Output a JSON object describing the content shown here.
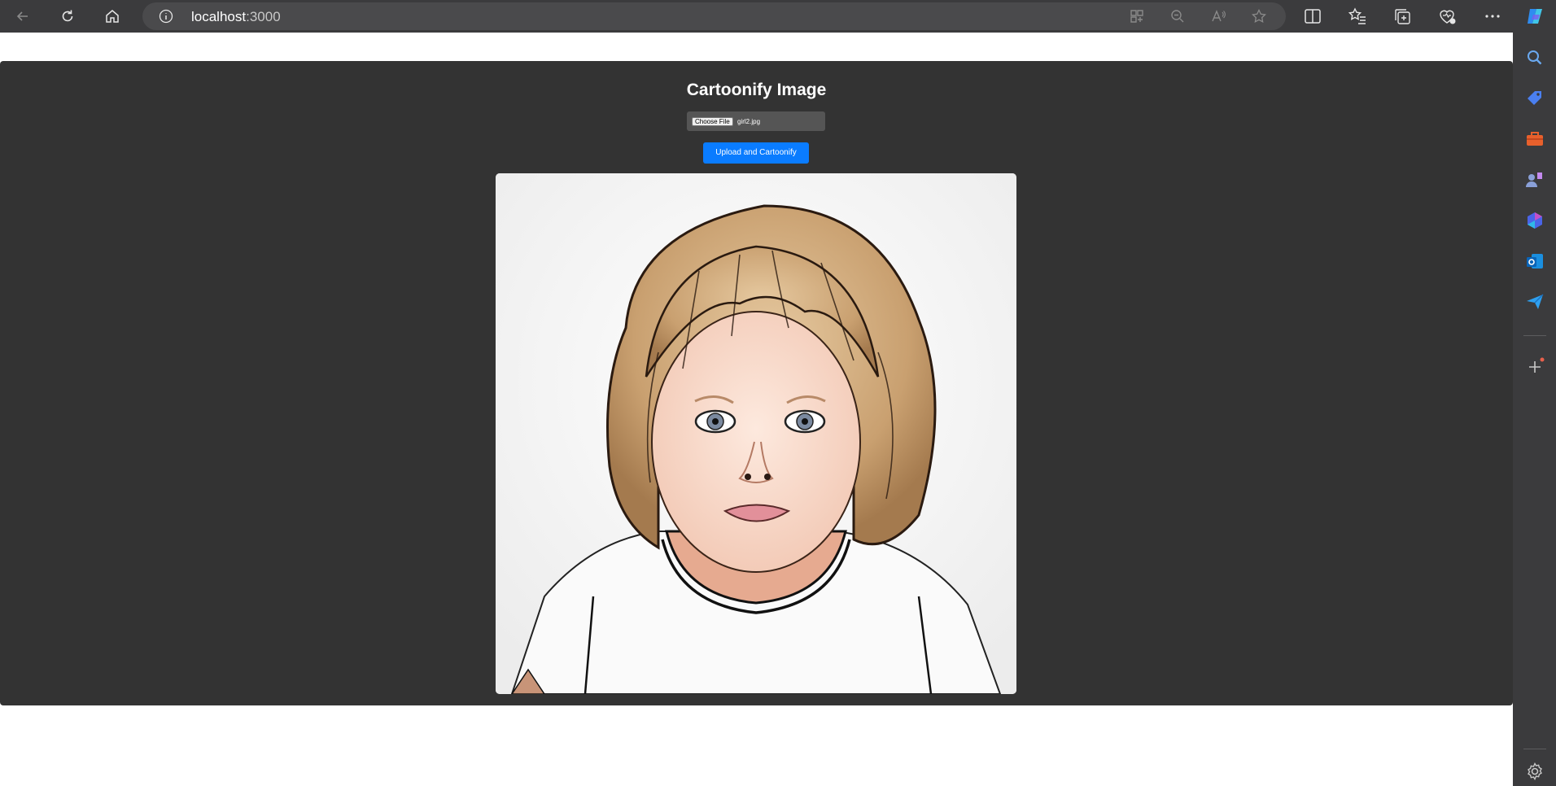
{
  "browser": {
    "address": "localhost",
    "port": ":3000"
  },
  "app": {
    "title": "Cartoonify Image",
    "choose_file_label": "Choose File",
    "file_name": "girl2.jpg",
    "upload_label": "Upload and Cartoonify"
  },
  "icons": {
    "back": "back-arrow-icon",
    "refresh": "refresh-icon",
    "home": "home-icon",
    "info": "info-icon",
    "app_grid": "app-grid-icon",
    "zoom": "zoom-out-icon",
    "read_aloud": "read-aloud-icon",
    "favorite": "star-icon",
    "split": "split-screen-icon",
    "favorites": "favorites-icon",
    "collections": "collections-icon",
    "health": "browser-essentials-icon",
    "more": "more-icon",
    "copilot": "copilot-icon"
  },
  "colors": {
    "accent": "#0a7cff",
    "app_bg": "#333333"
  }
}
